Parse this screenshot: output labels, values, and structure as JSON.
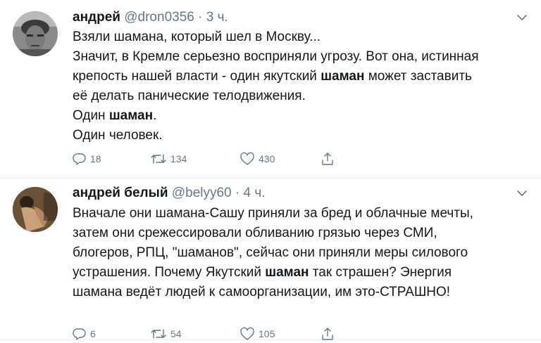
{
  "tweets": [
    {
      "author_name": "андрей",
      "handle": "@dron0356",
      "separator": "·",
      "time": "3 ч.",
      "avatar_icon": "avatar-photo",
      "lines": [
        {
          "segments": [
            "Взяли шамана, который шел в Москву..."
          ]
        },
        {
          "segments": [
            "Значит, в Кремле серьезно восприняли угрозу. Вот она, истинная"
          ]
        },
        {
          "segments": [
            "крепость нашей власти - один якутский ",
            "шаман",
            " может заставить"
          ]
        },
        {
          "segments": [
            "её делать панические телодвижения."
          ]
        },
        {
          "segments": [
            "Один ",
            "шаман",
            "."
          ]
        },
        {
          "segments": [
            "Один человек."
          ]
        }
      ],
      "replies": "18",
      "retweets": "134",
      "likes": "430"
    },
    {
      "author_name": "андрей белый",
      "handle": "@belyy60",
      "separator": "·",
      "time": "4 ч.",
      "avatar_icon": "avatar-photo",
      "lines": [
        {
          "segments": [
            "Вначале они шамана-Сашу приняли за бред и облачные мечты,"
          ]
        },
        {
          "segments": [
            "затем они срежессировали обливанию грязью через СМИ,"
          ]
        },
        {
          "segments": [
            "блогеров, РПЦ,  \"шаманов\", сейчас они приняли меры силового"
          ]
        },
        {
          "segments": [
            "устрашения. Почему Якутский ",
            "шаман",
            " так страшен? Энергия"
          ]
        },
        {
          "segments": [
            "шамана ведёт людей к самоорганизации, им это-СТРАШНО!"
          ]
        }
      ],
      "replies": "6",
      "retweets": "54",
      "likes": "105"
    }
  ],
  "icons": {
    "reply": "reply-icon",
    "retweet": "retweet-icon",
    "like": "heart-icon",
    "share": "share-icon",
    "menu": "chevron-down-icon"
  },
  "colors": {
    "text": "#14171a",
    "secondary": "#657786",
    "divider": "#e6ecf0"
  }
}
